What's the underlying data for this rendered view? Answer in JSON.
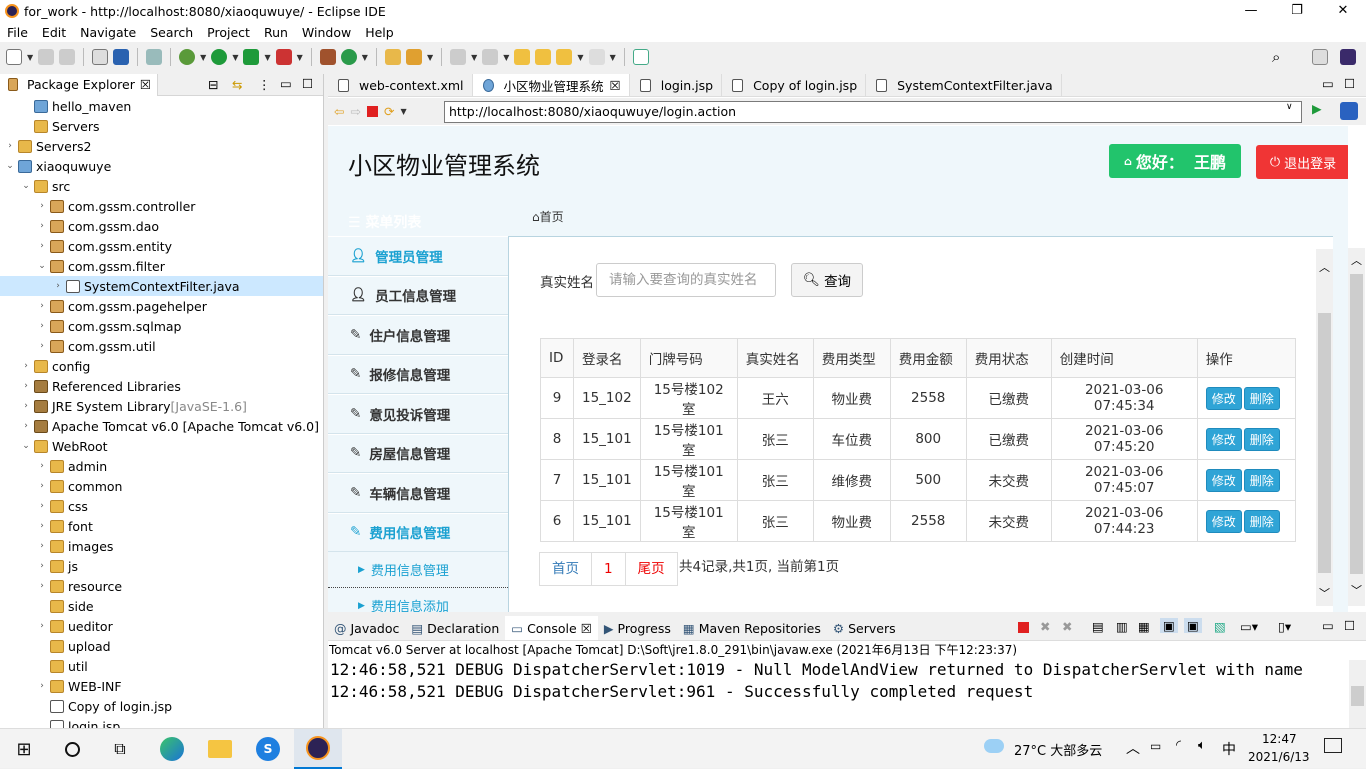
{
  "window": {
    "title": "for_work - http://localhost:8080/xiaoquwuye/ - Eclipse IDE",
    "minimize": "—",
    "maximize": "❐",
    "close": "✕"
  },
  "menu": [
    "File",
    "Edit",
    "Navigate",
    "Search",
    "Project",
    "Run",
    "Window",
    "Help"
  ],
  "package_explorer": {
    "title": "Package Explorer",
    "tree": [
      {
        "label": "hello_maven",
        "level": 1,
        "icon": "project",
        "arrow": ""
      },
      {
        "label": "Servers",
        "level": 1,
        "icon": "folder",
        "arrow": ""
      },
      {
        "label": "Servers2",
        "level": 0,
        "icon": "folder",
        "arrow": ">"
      },
      {
        "label": "xiaoquwuye",
        "level": 0,
        "icon": "project",
        "arrow": "v"
      },
      {
        "label": "src",
        "level": 1,
        "icon": "folder",
        "arrow": "v"
      },
      {
        "label": "com.gssm.controller",
        "level": 2,
        "icon": "package",
        "arrow": ">"
      },
      {
        "label": "com.gssm.dao",
        "level": 2,
        "icon": "package",
        "arrow": ">"
      },
      {
        "label": "com.gssm.entity",
        "level": 2,
        "icon": "package",
        "arrow": ">"
      },
      {
        "label": "com.gssm.filter",
        "level": 2,
        "icon": "package",
        "arrow": "v"
      },
      {
        "label": "SystemContextFilter.java",
        "level": 3,
        "icon": "file",
        "arrow": ">",
        "selected": true
      },
      {
        "label": "com.gssm.pagehelper",
        "level": 2,
        "icon": "package",
        "arrow": ">"
      },
      {
        "label": "com.gssm.sqlmap",
        "level": 2,
        "icon": "package",
        "arrow": ">"
      },
      {
        "label": "com.gssm.util",
        "level": 2,
        "icon": "package",
        "arrow": ">"
      },
      {
        "label": "config",
        "level": 1,
        "icon": "folder",
        "arrow": ">"
      },
      {
        "label": "Referenced Libraries",
        "level": 1,
        "icon": "library",
        "arrow": ">"
      },
      {
        "label": "JRE System Library",
        "suffix": "[JavaSE-1.6]",
        "level": 1,
        "icon": "library",
        "arrow": ">"
      },
      {
        "label": "Apache Tomcat v6.0 [Apache Tomcat v6.0]",
        "level": 1,
        "icon": "library",
        "arrow": ">"
      },
      {
        "label": "WebRoot",
        "level": 1,
        "icon": "folder",
        "arrow": "v"
      },
      {
        "label": "admin",
        "level": 2,
        "icon": "folder",
        "arrow": ">"
      },
      {
        "label": "common",
        "level": 2,
        "icon": "folder",
        "arrow": ">"
      },
      {
        "label": "css",
        "level": 2,
        "icon": "folder",
        "arrow": ">"
      },
      {
        "label": "font",
        "level": 2,
        "icon": "folder",
        "arrow": ">"
      },
      {
        "label": "images",
        "level": 2,
        "icon": "folder",
        "arrow": ">"
      },
      {
        "label": "js",
        "level": 2,
        "icon": "folder",
        "arrow": ">"
      },
      {
        "label": "resource",
        "level": 2,
        "icon": "folder",
        "arrow": ">"
      },
      {
        "label": "side",
        "level": 2,
        "icon": "folder",
        "arrow": ""
      },
      {
        "label": "ueditor",
        "level": 2,
        "icon": "folder",
        "arrow": ">"
      },
      {
        "label": "upload",
        "level": 2,
        "icon": "folder",
        "arrow": ""
      },
      {
        "label": "util",
        "level": 2,
        "icon": "folder",
        "arrow": ""
      },
      {
        "label": "WEB-INF",
        "level": 2,
        "icon": "folder",
        "arrow": ">"
      },
      {
        "label": "Copy of login.jsp",
        "level": 2,
        "icon": "file",
        "arrow": ""
      },
      {
        "label": "login.jsp",
        "level": 2,
        "icon": "file",
        "arrow": ""
      }
    ]
  },
  "editor_tabs": [
    {
      "label": "web-context.xml"
    },
    {
      "label": "小区物业管理系统",
      "active": true
    },
    {
      "label": "login.jsp"
    },
    {
      "label": "Copy of login.jsp"
    },
    {
      "label": "SystemContextFilter.java"
    }
  ],
  "browser": {
    "url": "http://localhost:8080/xiaoquwuye/login.action"
  },
  "site": {
    "title": "小区物业管理系统",
    "greeting": "您好：",
    "user": "王鹏",
    "logout": "退出登录",
    "menu_head": "菜单列表",
    "breadcrumb": "首页",
    "menu": [
      {
        "label": "管理员管理",
        "icon": "user-icon",
        "active": true
      },
      {
        "label": "员工信息管理",
        "icon": "user-icon"
      },
      {
        "label": "住户信息管理",
        "icon": "edit-icon"
      },
      {
        "label": "报修信息管理",
        "icon": "edit-icon"
      },
      {
        "label": "意见投诉管理",
        "icon": "edit-icon"
      },
      {
        "label": "房屋信息管理",
        "icon": "edit-icon"
      },
      {
        "label": "车辆信息管理",
        "icon": "edit-icon"
      },
      {
        "label": "费用信息管理",
        "icon": "edit-icon",
        "active": true
      }
    ],
    "submenu": [
      "费用信息管理",
      "费用信息添加"
    ],
    "search": {
      "label": "真实姓名",
      "placeholder": "请输入要查询的真实姓名",
      "button": "查询"
    },
    "table": {
      "headers": [
        "ID",
        "登录名",
        "门牌号码",
        "真实姓名",
        "费用类型",
        "费用金额",
        "费用状态",
        "创建时间",
        "操作"
      ],
      "rows": [
        [
          "9",
          "15_102",
          "15号楼102室",
          "王六",
          "物业费",
          "2558",
          "已缴费",
          "2021-03-06 07:45:34"
        ],
        [
          "8",
          "15_101",
          "15号楼101室",
          "张三",
          "车位费",
          "800",
          "已缴费",
          "2021-03-06 07:45:20"
        ],
        [
          "7",
          "15_101",
          "15号楼101室",
          "张三",
          "维修费",
          "500",
          "未交费",
          "2021-03-06 07:45:07"
        ],
        [
          "6",
          "15_101",
          "15号楼101室",
          "张三",
          "物业费",
          "2558",
          "未交费",
          "2021-03-06 07:44:23"
        ]
      ],
      "edit": "修改",
      "delete": "删除"
    },
    "pager": {
      "first": "首页",
      "page": "1",
      "last": "尾页",
      "info": "共4记录,共1页, 当前第1页"
    },
    "colors": {
      "green": "#22c46c",
      "red": "#f03535",
      "accent": "#1ba1d1",
      "button_blue": "#2fa4d6"
    }
  },
  "bottom_tabs": [
    "Javadoc",
    "Declaration",
    "Console",
    "Progress",
    "Maven Repositories",
    "Servers"
  ],
  "console": {
    "desc": "Tomcat v6.0 Server at localhost [Apache Tomcat] D:\\Soft\\jre1.8.0_291\\bin\\javaw.exe  (2021年6月13日 下午12:23:37)",
    "lines": [
      "12:46:58,521 DEBUG DispatcherServlet:1019 - Null ModelAndView returned to DispatcherServlet with name",
      "12:46:58,521 DEBUG DispatcherServlet:961 - Successfully completed request"
    ]
  },
  "taskbar": {
    "weather": "27°C  大部多云",
    "ime": "中",
    "time": "12:47",
    "date": "2021/6/13"
  }
}
